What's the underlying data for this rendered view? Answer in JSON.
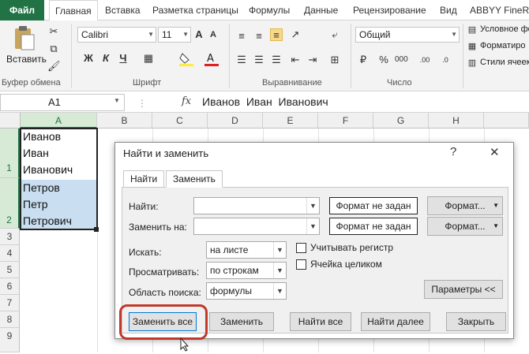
{
  "ribbon_tabs": [
    "Файл",
    "Главная",
    "Вставка",
    "Разметка страницы",
    "Формулы",
    "Данные",
    "Рецензирование",
    "Вид",
    "ABBYY FineRea"
  ],
  "ribbon": {
    "clipboard": {
      "paste_label": "Вставить",
      "group_label": "Буфер обмена"
    },
    "font": {
      "font_name": "Calibri",
      "font_size": "11",
      "group_label": "Шрифт",
      "bold": "Ж",
      "italic": "К",
      "underline": "Ч"
    },
    "alignment": {
      "group_label": "Выравнивание"
    },
    "number": {
      "format": "Общий",
      "group_label": "Число"
    },
    "styles": {
      "conditional": "Условное фо",
      "format_table": "Форматиро",
      "cell_styles": "Стили ячеек"
    }
  },
  "formula_bar": {
    "name_box": "A1",
    "fx": "fx",
    "content": "Иванов  Иван  Иванович"
  },
  "columns": [
    "A",
    "B",
    "C",
    "D",
    "E",
    "F",
    "G",
    "H"
  ],
  "rows": [
    "1",
    "2",
    "3",
    "4",
    "5",
    "6",
    "7",
    "8",
    "9"
  ],
  "cells": [
    "Иванов",
    "Иван",
    "Иванович",
    "Петров",
    "Петр",
    "Петрович"
  ],
  "dialog": {
    "title": "Найти и заменить",
    "help": "?",
    "close": "✕",
    "tabs": [
      "Найти",
      "Заменить"
    ],
    "find_label": "Найти:",
    "replace_label": "Заменить на:",
    "format_not_set": "Формат не задан",
    "format_button": "Формат...",
    "search_label": "Искать:",
    "search_value": "на листе",
    "look_by_label": "Просматривать:",
    "look_by_value": "по строкам",
    "area_label": "Область поиска:",
    "area_value": "формулы",
    "match_case": "Учитывать регистр",
    "whole_cell": "Ячейка целиком",
    "params_button": "Параметры <<",
    "replace_all": "Заменить все",
    "replace": "Заменить",
    "find_all": "Найти все",
    "find_next": "Найти далее",
    "close_button": "Закрыть"
  },
  "colors": {
    "excel_green": "#217346",
    "selection": "#c9def0",
    "highlight_ring": "#c0392b"
  }
}
